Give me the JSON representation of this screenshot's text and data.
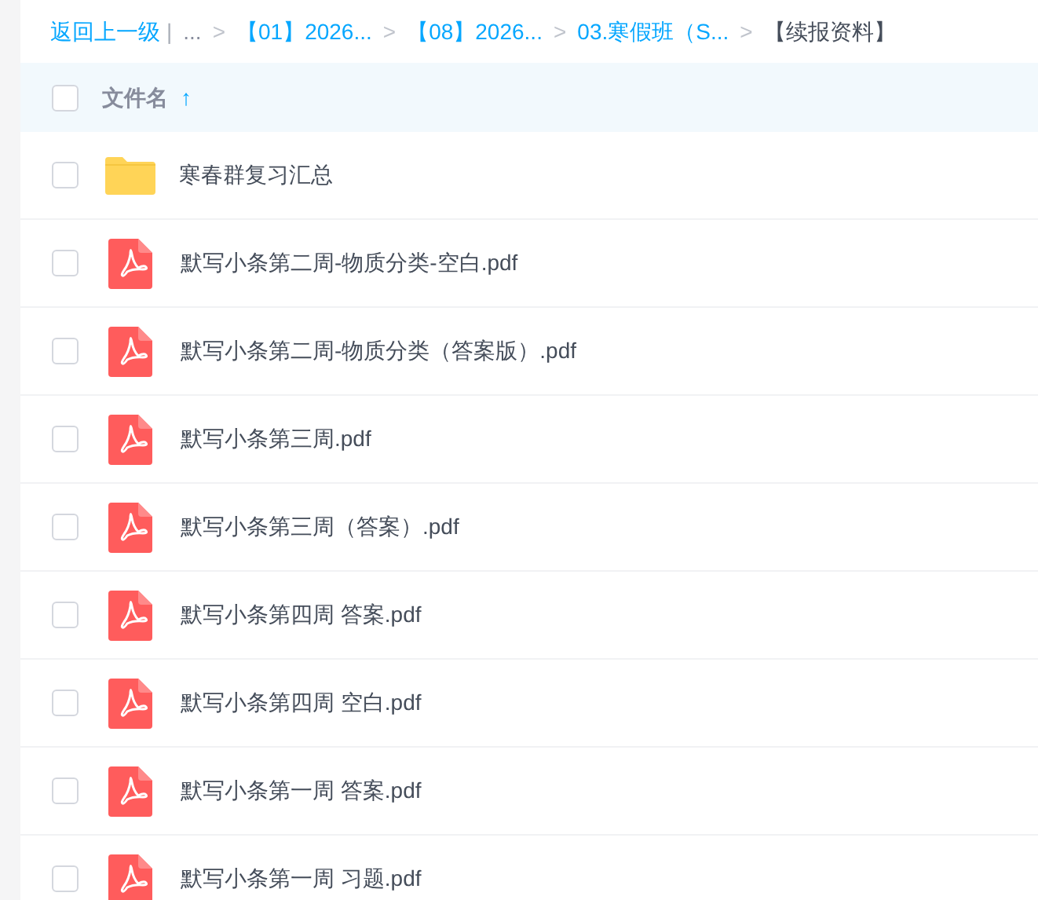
{
  "breadcrumb": {
    "back": "返回上一级",
    "separator": "|",
    "ellipsis": "...",
    "items": [
      {
        "label": "【01】2026...",
        "current": false
      },
      {
        "label": "【08】2026...",
        "current": false
      },
      {
        "label": "03.寒假班（S...",
        "current": false
      },
      {
        "label": "【续报资料】",
        "current": true
      }
    ],
    "arrow": ">"
  },
  "header": {
    "checked": false,
    "column": "文件名",
    "sort_arrow": "↑"
  },
  "rows": [
    {
      "kind": "folder",
      "name": "寒春群复习汇总",
      "checked": false
    },
    {
      "kind": "pdf",
      "name": "默写小条第二周-物质分类-空白.pdf",
      "checked": false
    },
    {
      "kind": "pdf",
      "name": "默写小条第二周-物质分类（答案版）.pdf",
      "checked": false
    },
    {
      "kind": "pdf",
      "name": "默写小条第三周.pdf",
      "checked": false
    },
    {
      "kind": "pdf",
      "name": "默写小条第三周（答案）.pdf",
      "checked": false
    },
    {
      "kind": "pdf",
      "name": "默写小条第四周 答案.pdf",
      "checked": false
    },
    {
      "kind": "pdf",
      "name": "默写小条第四周 空白.pdf",
      "checked": false
    },
    {
      "kind": "pdf",
      "name": "默写小条第一周 答案.pdf",
      "checked": false
    },
    {
      "kind": "pdf",
      "name": "默写小条第一周 习题.pdf",
      "checked": false
    }
  ]
}
